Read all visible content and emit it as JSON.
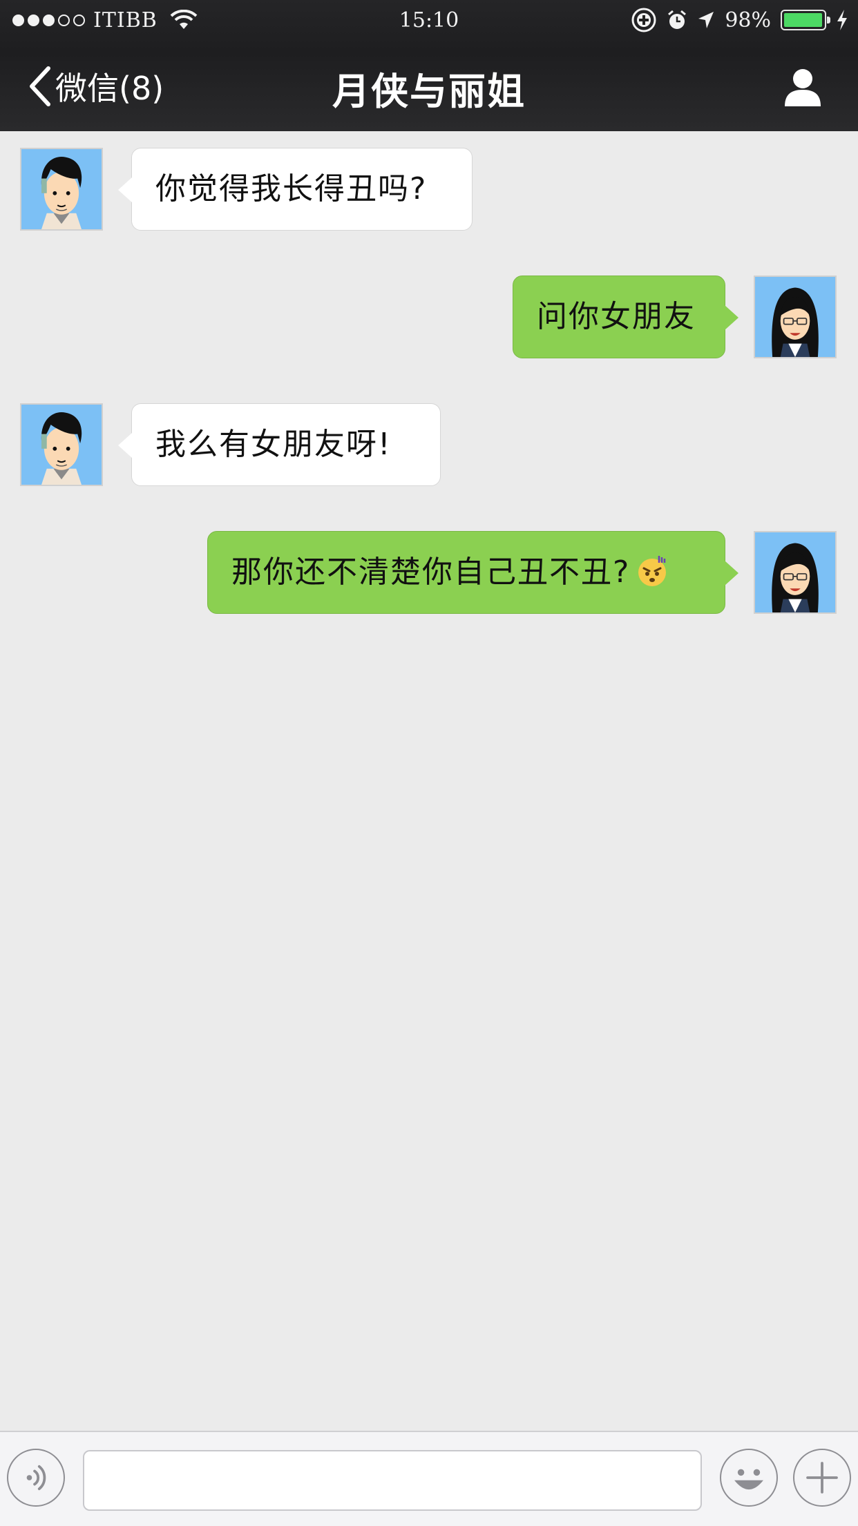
{
  "status_bar": {
    "carrier": "ITIBB",
    "time": "15:10",
    "battery_text": "98%",
    "battery_level": 0.98,
    "signal_bars_filled": 3,
    "signal_bars_total": 5,
    "battery_color": "#4cd964"
  },
  "nav": {
    "back_label": "微信(8)",
    "title": "月侠与丽姐",
    "profile_icon": "person-icon"
  },
  "messages": [
    {
      "side": "in",
      "sender": "contact",
      "text": "你觉得我长得丑吗?"
    },
    {
      "side": "out",
      "sender": "me",
      "text": "问你女朋友"
    },
    {
      "side": "in",
      "sender": "contact",
      "text": "我么有女朋友呀!"
    },
    {
      "side": "out",
      "sender": "me",
      "text": "那你还不清楚你自己丑不丑?",
      "emoji": "angry-emoji"
    }
  ],
  "input_bar": {
    "voice_icon": "voice-icon",
    "text_value": "",
    "emoji_icon": "smiley-icon",
    "plus_icon": "plus-icon"
  },
  "colors": {
    "outgoing_bubble": "#8bd051",
    "incoming_bubble": "#ffffff",
    "chat_background": "#ebebeb",
    "header_background": "#232325"
  }
}
